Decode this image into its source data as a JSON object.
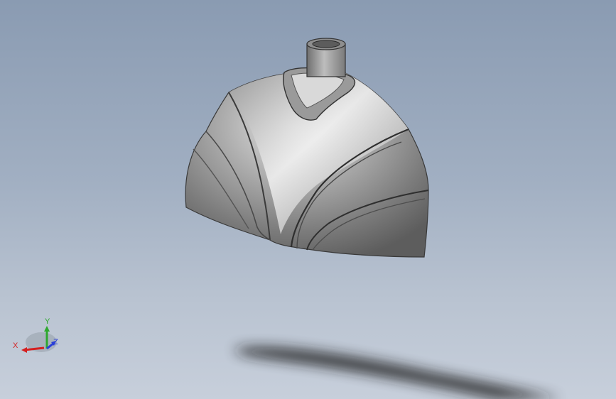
{
  "viewport": {
    "background_top": "#8a9bb2",
    "background_bottom": "#c7cfdb"
  },
  "model": {
    "icon": "3d-part-model",
    "body_color": "#8f8f8f",
    "shadow_color": "#1e1e1e"
  },
  "triad": {
    "x_label": "X",
    "y_label": "Y",
    "z_label": "Z",
    "x_color": "#d42020",
    "y_color": "#2ea82e",
    "z_color": "#2a3fd8"
  }
}
